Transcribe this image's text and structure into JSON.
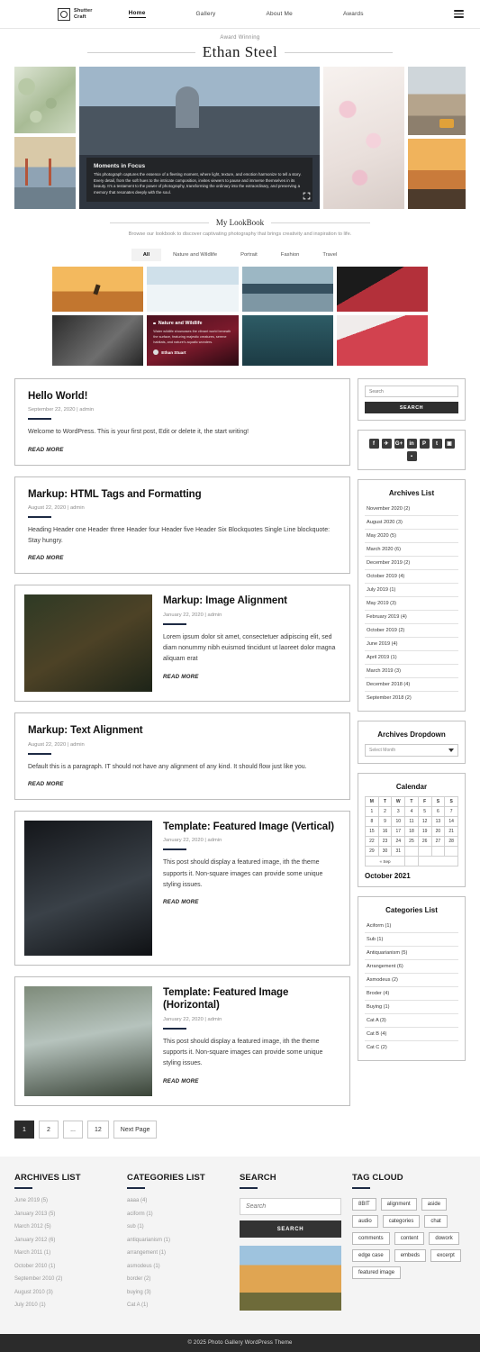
{
  "header": {
    "brand_line1": "Shutter",
    "brand_line2": "Craft",
    "nav": [
      {
        "label": "Home",
        "active": true
      },
      {
        "label": "Gallery",
        "active": false
      },
      {
        "label": "About Me",
        "active": false
      },
      {
        "label": "Awards",
        "active": false
      }
    ],
    "menu_icon": "hamburger-icon"
  },
  "hero": {
    "eyebrow": "Award Winning",
    "name": "Ethan Steel",
    "caption_title": "Moments in Focus",
    "caption_text": "This photograph captures the essence of a fleeting moment, where light, texture, and emotion harmonize to tell a story. Every detail, from the soft hues to the intricate composition, invites viewers to pause and immerse themselves in its beauty. It's a testament to the power of photography, transforming the ordinary into the extraordinary, and preserving a memory that resonates deeply with the soul.",
    "expand_icon": "expand-icon"
  },
  "lookbook": {
    "title": "My LookBook",
    "subtitle": "Browse our lookbook to discover captivating photography that brings creativity and inspiration to life.",
    "filters": [
      {
        "label": "All",
        "active": true
      },
      {
        "label": "Nature and Wildlife",
        "active": false
      },
      {
        "label": "Portrait",
        "active": false
      },
      {
        "label": "Fashion",
        "active": false
      },
      {
        "label": "Travel",
        "active": false
      }
    ],
    "card": {
      "title": "Nature and Wildlife",
      "text": "Water wildlife showcases the vibrant world beneath the surface, featuring majestic creatures, serene habitats, and nature's aquatic wonders.",
      "author": "Ethan Stuart"
    }
  },
  "posts": [
    {
      "title": "Hello World!",
      "meta": "September 22, 2020 | admin",
      "excerpt": "Welcome to WordPress. This is your first post, Edit or delete it, the start writing!",
      "read_more": "READ MORE",
      "image": null
    },
    {
      "title": "Markup: HTML Tags and Formatting",
      "meta": "August 22, 2020 | admin",
      "excerpt": "Heading Header one Header three Header four Header five Header Six Blockquotes Single Line blockquote: Stay hungry.",
      "read_more": "READ MORE",
      "image": null
    },
    {
      "title": "Markup: Image Alignment",
      "meta": "January 22, 2020 | admin",
      "excerpt": "Lorem ipsum dolor sit amet, consectetuer adipiscing elit, sed diam nonummy nibh euismod tincidunt ut laoreet dolor magna aliquam erat",
      "read_more": "READ MORE",
      "image": "berries"
    },
    {
      "title": "Markup: Text Alignment",
      "meta": "August 22, 2020 | admin",
      "excerpt": "Default this is a paragraph. IT should not have any alignment of any kind. It should flow just like you.",
      "read_more": "READ MORE",
      "image": null
    },
    {
      "title": "Template: Featured Image (Vertical)",
      "meta": "January 22, 2020 | admin",
      "excerpt": "This post should display a featured image, ith the theme supports it. Non-square images can provide some unique styling issues.",
      "read_more": "READ MORE",
      "image": "head"
    },
    {
      "title": "Template: Featured Image (Horizontal)",
      "meta": "January 22, 2020 | admin",
      "excerpt": "This post should display a featured image, ith the theme supports it. Non-square images can provide some unique styling issues.",
      "read_more": "READ MORE",
      "image": "eleph"
    }
  ],
  "pagination": [
    {
      "label": "1",
      "active": true
    },
    {
      "label": "2",
      "active": false
    },
    {
      "label": "...",
      "active": false
    },
    {
      "label": "12",
      "active": false
    },
    {
      "label": "Next Page",
      "active": false
    }
  ],
  "sidebar": {
    "search": {
      "placeholder": "Search",
      "button": "SEARCH"
    },
    "social": [
      {
        "icon": "facebook-icon",
        "glyph": "f"
      },
      {
        "icon": "twitter-icon",
        "glyph": "✈"
      },
      {
        "icon": "google-plus-icon",
        "glyph": "G+"
      },
      {
        "icon": "linkedin-icon",
        "glyph": "in"
      },
      {
        "icon": "pinterest-icon",
        "glyph": "P"
      },
      {
        "icon": "tumblr-icon",
        "glyph": "t"
      },
      {
        "icon": "instagram-icon",
        "glyph": "▣"
      },
      {
        "icon": "flickr-icon",
        "glyph": "▪"
      }
    ],
    "archives_title": "Archives List",
    "archives": [
      "November 2020 (2)",
      "August 2020 (3)",
      "May 2020 (5)",
      "March 2020 (6)",
      "December 2019 (2)",
      "October 2019 (4)",
      "July 2019 (1)",
      "May 2019 (3)",
      "February 2019 (4)",
      "October 2019 (2)",
      "June 2019 (4)",
      "April 2019 (1)",
      "March 2019 (3)",
      "December 2018 (4)",
      "September 2018 (2)"
    ],
    "dropdown_title": "Archives Dropdown",
    "dropdown_value": "Select Month",
    "calendar_title": "Calendar",
    "calendar_days": [
      "M",
      "T",
      "W",
      "T",
      "F",
      "S",
      "S"
    ],
    "calendar_rows": [
      [
        "1",
        "2",
        "3",
        "4",
        "5",
        "6",
        "7"
      ],
      [
        "8",
        "9",
        "10",
        "11",
        "12",
        "13",
        "14"
      ],
      [
        "15",
        "16",
        "17",
        "18",
        "19",
        "20",
        "21"
      ],
      [
        "22",
        "23",
        "24",
        "25",
        "26",
        "27",
        "28"
      ],
      [
        "29",
        "30",
        "31",
        "",
        "",
        "",
        ""
      ]
    ],
    "calendar_prev": "« Sep",
    "calendar_month": "October 2021",
    "categories_title": "Categories List",
    "categories": [
      "Aciform (1)",
      "Sub (1)",
      "Antiquarianism (5)",
      "Arrangement (6)",
      "Asmodeus (2)",
      "Broder (4)",
      "Buying (1)",
      "Cat A (3)",
      "Cat B (4)",
      "Cat C (2)"
    ]
  },
  "footer": {
    "archives_title": "ARCHIVES LIST",
    "archives": [
      "June 2019 (5)",
      "January  2013 (5)",
      "March 2012 (5)",
      "January  2012 (6)",
      "March  2011 (1)",
      "October 2010 (1)",
      "September 2010 (2)",
      "August 2010 (3)",
      "July 2010 (1)"
    ],
    "categories_title": "CATEGORIES LIST",
    "categories": [
      "aaaa (4)",
      "aciform (1)",
      "sub (1)",
      "antiquarianism (1)",
      "arrangement (1)",
      "asmodeus (1)",
      "border (2)",
      "buying (3)",
      "Cat A (1)"
    ],
    "search_title": "SEARCH",
    "search_placeholder": "Search",
    "search_button": "SEARCH",
    "tag_title": "TAG CLOUD",
    "tags": [
      "8BIT",
      "alignment",
      "aside",
      "audio",
      "categories",
      "chat",
      "comments",
      "content",
      "dowork",
      "edge case",
      "embeds",
      "excerpt",
      "featured image"
    ],
    "copyright": "© 2025  Photo Gallery WordPress Theme"
  }
}
